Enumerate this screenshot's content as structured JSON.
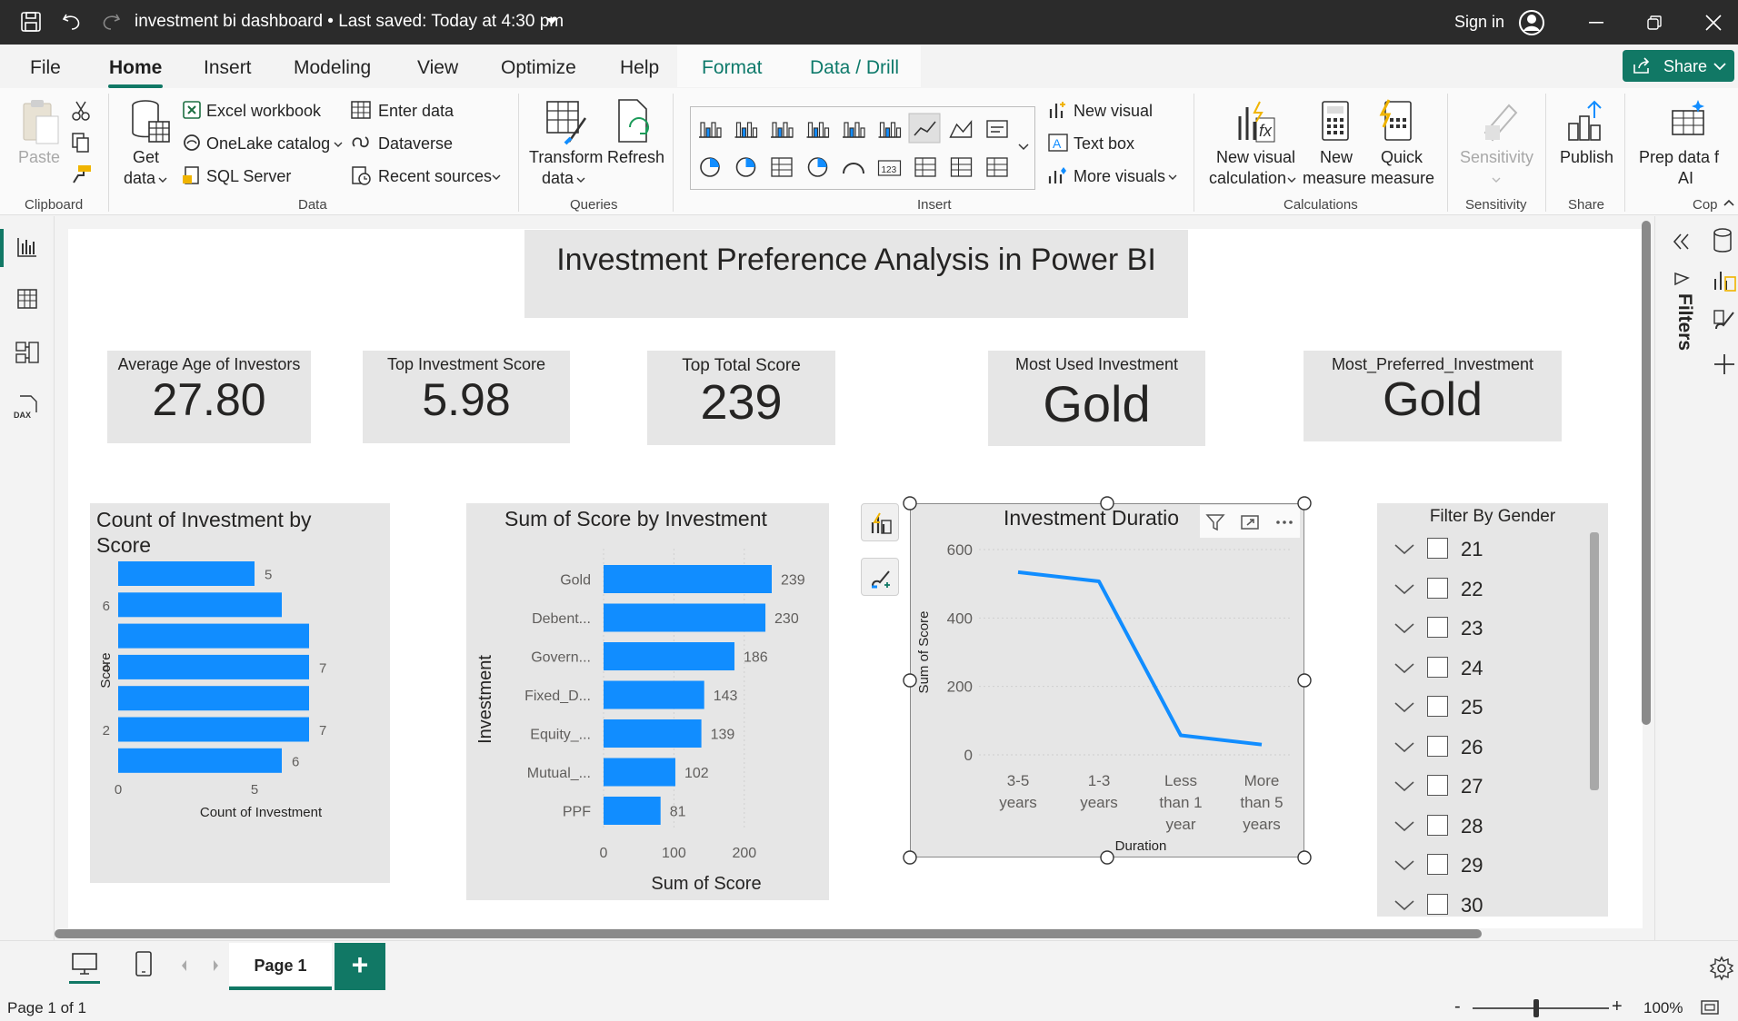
{
  "titlebar": {
    "title": "investment bi dashboard",
    "saved": "Last saved: Today at 4:30 pm",
    "sign_in": "Sign in"
  },
  "tabs": [
    "File",
    "Home",
    "Insert",
    "Modeling",
    "View",
    "Optimize",
    "Help",
    "Format",
    "Data / Drill"
  ],
  "share_label": "Share",
  "ribbon": {
    "clipboard": {
      "paste": "Paste",
      "group": "Clipboard"
    },
    "data": {
      "get_data_1": "Get",
      "get_data_2": "data",
      "excel": "Excel workbook",
      "onelake": "OneLake catalog",
      "sql": "SQL Server",
      "enter_data": "Enter data",
      "dataverse": "Dataverse",
      "recent": "Recent sources",
      "group": "Data"
    },
    "queries": {
      "transform_1": "Transform",
      "transform_2": "data",
      "refresh": "Refresh",
      "group": "Queries"
    },
    "insert": {
      "new_visual": "New visual",
      "text_box": "Text box",
      "more_visuals": "More visuals",
      "group": "Insert"
    },
    "calculations": {
      "nvc_1": "New visual",
      "nvc_2": "calculation",
      "nm_1": "New",
      "nm_2": "measure",
      "qm_1": "Quick",
      "qm_2": "measure",
      "group": "Calculations"
    },
    "sensitivity": {
      "label": "Sensitivity",
      "group": "Sensitivity"
    },
    "share": {
      "publish": "Publish",
      "group": "Share"
    },
    "copilot": {
      "prep_1": "Prep data f",
      "prep_2": "AI",
      "group": "Cop"
    }
  },
  "dashboard": {
    "title": "Investment Preference Analysis in Power BI",
    "kpis": [
      {
        "label": "Average Age of Investors",
        "value": "27.80"
      },
      {
        "label": "Top Investment Score",
        "value": "5.98"
      },
      {
        "label": "Top Total Score",
        "value": "239"
      },
      {
        "label": "Most Used Investment",
        "value": "Gold"
      },
      {
        "label": "Most_Preferred_Investment",
        "value": "Gold"
      }
    ],
    "slicer": {
      "title": "Filter By Gender",
      "items": [
        "21",
        "22",
        "23",
        "24",
        "25",
        "26",
        "27",
        "28",
        "29",
        "30"
      ]
    }
  },
  "chart_data": [
    {
      "type": "bar",
      "orientation": "horizontal",
      "title": "Count of Investment by Score",
      "xlabel": "Count of Investment",
      "ylabel": "Score",
      "xlim": [
        0,
        7
      ],
      "x_ticks": [
        "0",
        "5"
      ],
      "y_tick_labels": [
        "",
        "6",
        "",
        "4",
        "",
        "2",
        ""
      ],
      "values": [
        5,
        6,
        7,
        7,
        7,
        7,
        6
      ],
      "data_labels": [
        "5",
        "",
        "",
        "7",
        "",
        "7",
        "6"
      ],
      "color": "#118dff"
    },
    {
      "type": "bar",
      "orientation": "horizontal",
      "title": "Sum of Score by Investment",
      "xlabel": "Sum of Score",
      "ylabel": "Investment",
      "categories": [
        "Gold",
        "Debent...",
        "Govern...",
        "Fixed_D...",
        "Equity_...",
        "Mutual_...",
        "PPF"
      ],
      "values": [
        239,
        230,
        186,
        143,
        139,
        102,
        81
      ],
      "xlim": [
        0,
        250
      ],
      "x_ticks": [
        0,
        100,
        200
      ],
      "color": "#118dff"
    },
    {
      "type": "line",
      "title": "Investment Duratio",
      "xlabel": "Duration",
      "ylabel": "Sum of Score",
      "categories": [
        [
          "3-5",
          "years"
        ],
        [
          "1-3",
          "years"
        ],
        [
          "Less",
          "than 1",
          "year"
        ],
        [
          "More",
          "than 5",
          "years"
        ]
      ],
      "values": [
        534,
        507,
        57,
        30
      ],
      "ylim": [
        0,
        650
      ],
      "y_ticks": [
        0,
        200,
        400,
        600
      ],
      "color": "#118dff"
    }
  ],
  "page_tabs": {
    "page": "Page 1",
    "add": "+"
  },
  "status": {
    "page_of": "Page 1 of 1",
    "zoom": "100%",
    "minus": "-",
    "plus": "+"
  },
  "filters_label": "Filters"
}
